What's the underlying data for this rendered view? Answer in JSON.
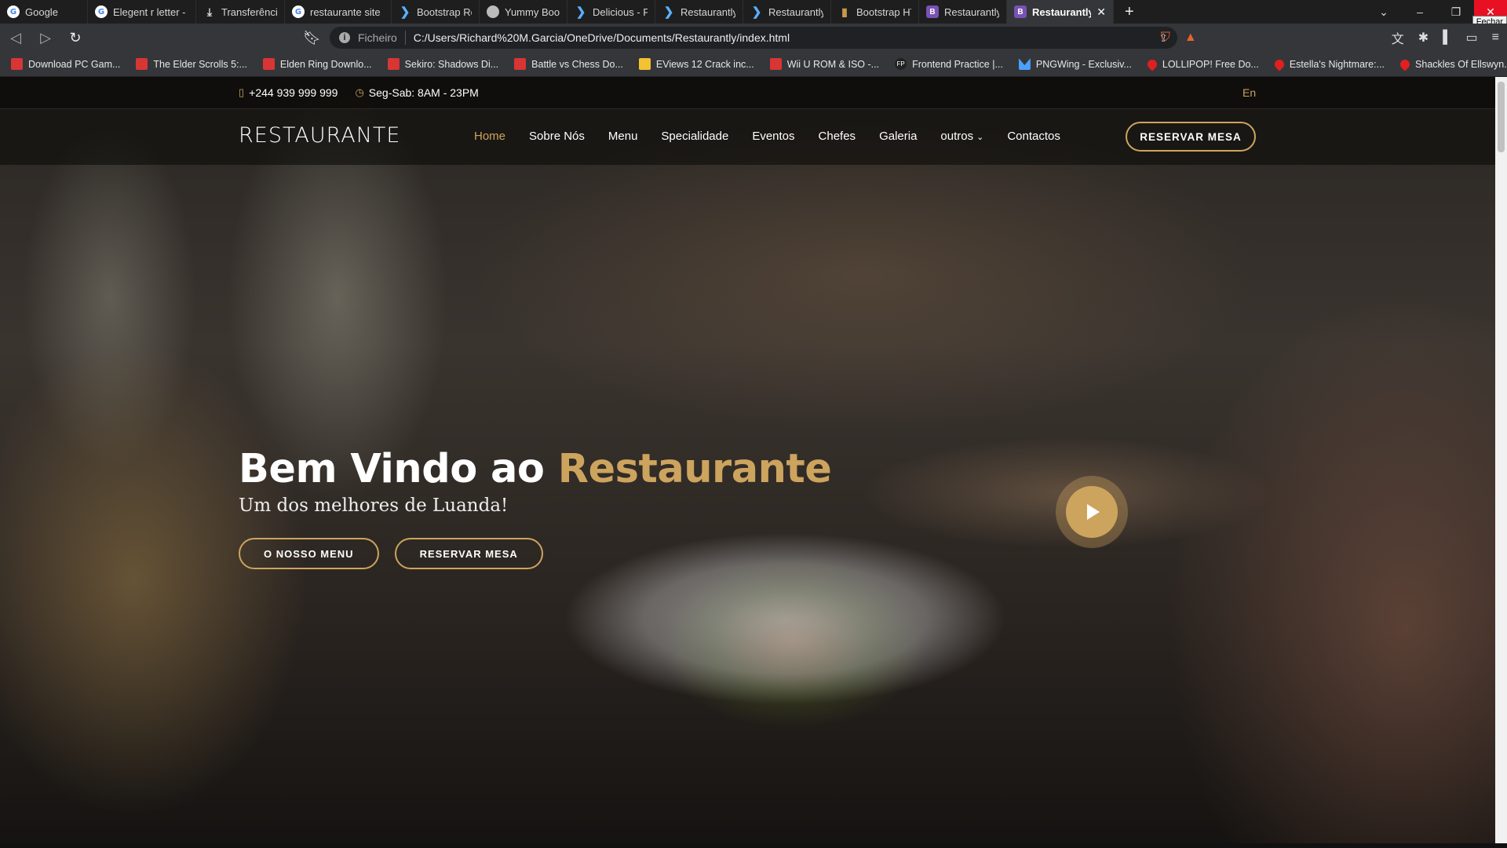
{
  "browser": {
    "tabs": [
      {
        "title": "Google",
        "icon": "google-icon",
        "fav": "G",
        "cls": "g"
      },
      {
        "title": "Elegent r letter - Pc",
        "icon": "google-icon",
        "fav": "G",
        "cls": "g"
      },
      {
        "title": "Transferências",
        "icon": "download-icon",
        "fav": "⤓",
        "cls": "dl"
      },
      {
        "title": "restaurante site boo",
        "icon": "google-icon",
        "fav": "G",
        "cls": "g"
      },
      {
        "title": "Bootstrap Restaura",
        "icon": "bootstrapmade-icon",
        "fav": "❯",
        "cls": "w"
      },
      {
        "title": "Yummy Bootstrap",
        "icon": "globe-icon",
        "fav": "",
        "cls": "k"
      },
      {
        "title": "Delicious - Free Re",
        "icon": "bootstrapmade-icon",
        "fav": "❯",
        "cls": "w"
      },
      {
        "title": "Restaurantly - Rest",
        "icon": "bootstrapmade-icon",
        "fav": "❯",
        "cls": "w"
      },
      {
        "title": "Restaurantly - Rest",
        "icon": "bootstrapmade-icon",
        "fav": "❯",
        "cls": "w"
      },
      {
        "title": "Bootstrap HTML Re",
        "icon": "document-icon",
        "fav": "▮",
        "cls": "d"
      },
      {
        "title": "Restaurantly Boots",
        "icon": "bootstrap-icon",
        "fav": "B",
        "cls": "b"
      },
      {
        "title": "Restaurantly B",
        "icon": "bootstrap-icon",
        "fav": "B",
        "cls": "b",
        "active": true
      }
    ],
    "new_tab": "+",
    "tooltip": "Fechar",
    "address": {
      "scheme_label": "Ficheiro",
      "url": "C:/Users/Richard%20M.Garcia/OneDrive/Documents/Restaurantly/index.html"
    },
    "bookmarks": [
      {
        "label": "Download PC Gam...",
        "cls": ""
      },
      {
        "label": "The Elder Scrolls 5:...",
        "cls": ""
      },
      {
        "label": "Elden Ring Downlo...",
        "cls": ""
      },
      {
        "label": "Sekiro: Shadows Di...",
        "cls": ""
      },
      {
        "label": "Battle vs Chess Do...",
        "cls": ""
      },
      {
        "label": "EViews 12 Crack inc...",
        "cls": "y"
      },
      {
        "label": "Wii U ROM & ISO -...",
        "cls": ""
      },
      {
        "label": "Frontend Practice |...",
        "cls": "fp"
      },
      {
        "label": "PNGWing - Exclusiv...",
        "cls": "png"
      },
      {
        "label": "LOLLIPOP! Free Do...",
        "cls": "drop"
      },
      {
        "label": "Estella's Nightmare:...",
        "cls": "drop"
      },
      {
        "label": "Shackles Of Ellswyn...",
        "cls": "drop"
      }
    ],
    "bookmarks_more": "»"
  },
  "site": {
    "topbar": {
      "phone": "+244 939 999 999",
      "hours": "Seg-Sab: 8AM - 23PM",
      "lang": "En"
    },
    "logo": "RESTAURANTE",
    "nav": [
      {
        "label": "Home",
        "active": true
      },
      {
        "label": "Sobre Nós"
      },
      {
        "label": "Menu"
      },
      {
        "label": "Specialidade"
      },
      {
        "label": "Eventos"
      },
      {
        "label": "Chefes"
      },
      {
        "label": "Galeria"
      },
      {
        "label": "outros",
        "dropdown": true
      },
      {
        "label": "Contactos"
      }
    ],
    "book_button": "RESERVAR MESA",
    "hero": {
      "title_part1": "Bem Vindo ao ",
      "title_accent": "Restaurante",
      "subtitle": "Um dos melhores de Luanda!",
      "menu_button": "O NOSSO MENU",
      "book_button": "RESERVAR MESA"
    },
    "colors": {
      "accent": "#cda45e"
    }
  }
}
